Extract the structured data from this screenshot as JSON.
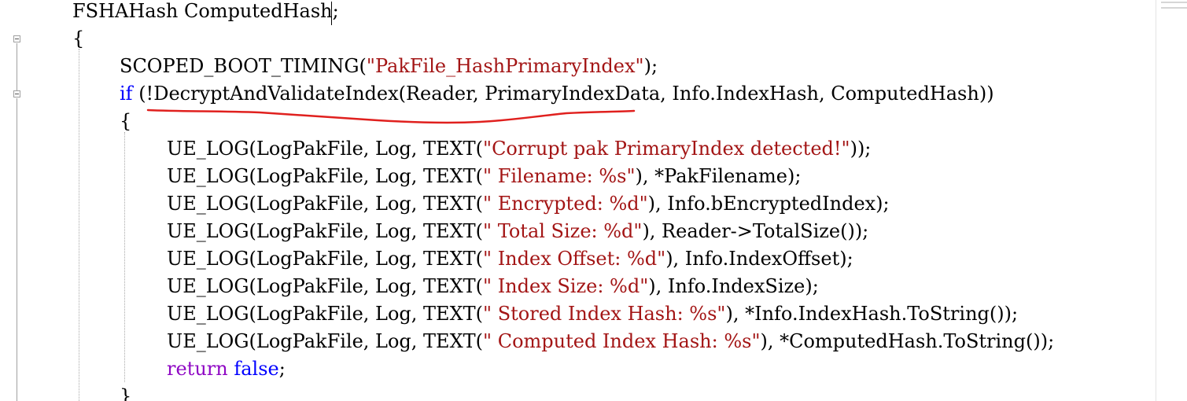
{
  "editor": {
    "lines": [
      {
        "indent": "    ",
        "tokens": [
          {
            "t": "FSHAHash ComputedHash;",
            "c": "type"
          }
        ]
      },
      {
        "indent": "    ",
        "tokens": [
          {
            "t": "{",
            "c": "type"
          }
        ]
      },
      {
        "indent": "        ",
        "tokens": [
          {
            "t": "SCOPED_BOOT_TIMING(",
            "c": "type"
          },
          {
            "t": "\"PakFile_HashPrimaryIndex\"",
            "c": "str"
          },
          {
            "t": ");",
            "c": "type"
          }
        ]
      },
      {
        "indent": "        ",
        "tokens": [
          {
            "t": "if",
            "c": "kw"
          },
          {
            "t": " (!DecryptAndValidateIndex(Reader, PrimaryIndexData, Info.IndexHash, ComputedHash))",
            "c": "type"
          }
        ]
      },
      {
        "indent": "        ",
        "tokens": [
          {
            "t": "{",
            "c": "type"
          }
        ]
      },
      {
        "indent": "            ",
        "tokens": [
          {
            "t": "UE_LOG(LogPakFile, Log, TEXT(",
            "c": "type"
          },
          {
            "t": "\"Corrupt pak PrimaryIndex detected!\"",
            "c": "str"
          },
          {
            "t": "));",
            "c": "type"
          }
        ]
      },
      {
        "indent": "            ",
        "tokens": [
          {
            "t": "UE_LOG(LogPakFile, Log, TEXT(",
            "c": "type"
          },
          {
            "t": "\" Filename: %s\"",
            "c": "str"
          },
          {
            "t": "), *PakFilename);",
            "c": "type"
          }
        ]
      },
      {
        "indent": "            ",
        "tokens": [
          {
            "t": "UE_LOG(LogPakFile, Log, TEXT(",
            "c": "type"
          },
          {
            "t": "\" Encrypted: %d\"",
            "c": "str"
          },
          {
            "t": "), Info.bEncryptedIndex);",
            "c": "type"
          }
        ]
      },
      {
        "indent": "            ",
        "tokens": [
          {
            "t": "UE_LOG(LogPakFile, Log, TEXT(",
            "c": "type"
          },
          {
            "t": "\" Total Size: %d\"",
            "c": "str"
          },
          {
            "t": "), Reader->TotalSize());",
            "c": "type"
          }
        ]
      },
      {
        "indent": "            ",
        "tokens": [
          {
            "t": "UE_LOG(LogPakFile, Log, TEXT(",
            "c": "type"
          },
          {
            "t": "\" Index Offset: %d\"",
            "c": "str"
          },
          {
            "t": "), Info.IndexOffset);",
            "c": "type"
          }
        ]
      },
      {
        "indent": "            ",
        "tokens": [
          {
            "t": "UE_LOG(LogPakFile, Log, TEXT(",
            "c": "type"
          },
          {
            "t": "\" Index Size: %d\"",
            "c": "str"
          },
          {
            "t": "), Info.IndexSize);",
            "c": "type"
          }
        ]
      },
      {
        "indent": "            ",
        "tokens": [
          {
            "t": "UE_LOG(LogPakFile, Log, TEXT(",
            "c": "type"
          },
          {
            "t": "\" Stored Index Hash: %s\"",
            "c": "str"
          },
          {
            "t": "), *Info.IndexHash.ToString());",
            "c": "type"
          }
        ]
      },
      {
        "indent": "            ",
        "tokens": [
          {
            "t": "UE_LOG(LogPakFile, Log, TEXT(",
            "c": "type"
          },
          {
            "t": "\" Computed Index Hash: %s\"",
            "c": "str"
          },
          {
            "t": "), *ComputedHash.ToString());",
            "c": "type"
          }
        ]
      },
      {
        "indent": "            ",
        "tokens": [
          {
            "t": "return",
            "c": "kw-purple"
          },
          {
            "t": " ",
            "c": "type"
          },
          {
            "t": "false",
            "c": "kw"
          },
          {
            "t": ";",
            "c": "type"
          }
        ]
      },
      {
        "indent": "        ",
        "tokens": [
          {
            "t": "}",
            "c": "type"
          }
        ]
      }
    ]
  },
  "colors": {
    "keyword": "#0000ff",
    "return_keyword": "#8f08c4",
    "string": "#a31515",
    "text": "#000000",
    "annotation_underline": "#e0201e"
  },
  "icons": {
    "fold_marker": "collapse-minus-icon"
  }
}
